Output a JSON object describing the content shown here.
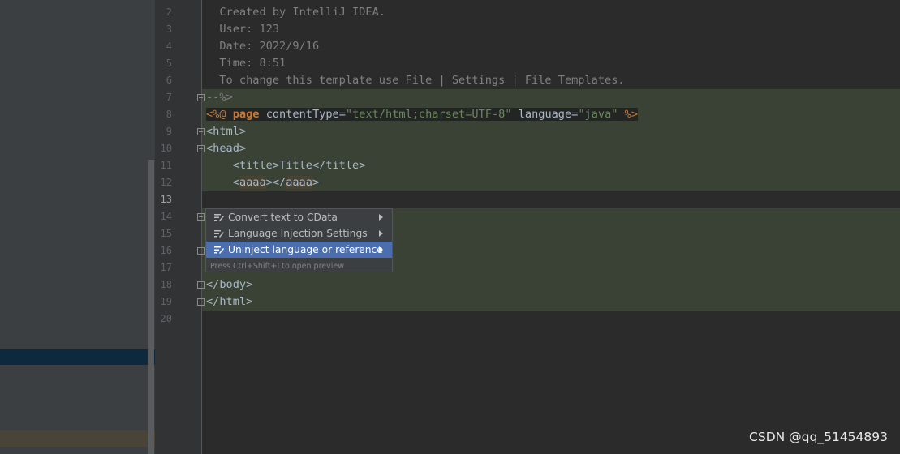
{
  "editor": {
    "lines": [
      {
        "num": "2",
        "text": "  Created by IntelliJ IDEA."
      },
      {
        "num": "3",
        "text": "  User: 123"
      },
      {
        "num": "4",
        "text": "  Date: 2022/9/16"
      },
      {
        "num": "5",
        "text": "  Time: 8:51"
      },
      {
        "num": "6",
        "text": "  To change this template use File | Settings | File Templates."
      },
      {
        "num": "7",
        "text": "--%>"
      },
      {
        "num": "8",
        "directive_open": "<%@",
        "kw": "page",
        "attr1": "contentType=",
        "val1": "\"text/html;charset=UTF-8\"",
        "attr2": "language=",
        "val2": "\"java\"",
        "directive_close": "%>"
      },
      {
        "num": "9",
        "text": "<html>"
      },
      {
        "num": "10",
        "text": "<head>"
      },
      {
        "num": "11",
        "text": "    <title>Title</title>"
      },
      {
        "num": "12",
        "indent": "    ",
        "open_lt": "<",
        "tag": "aaaa",
        "open_gt": "></",
        "tag2": "aaaa",
        "close_gt": ">"
      },
      {
        "num": "13",
        "text": ""
      },
      {
        "num": "14",
        "text": ""
      },
      {
        "num": "15",
        "text": ""
      },
      {
        "num": "16",
        "text": ""
      },
      {
        "num": "17",
        "text": ""
      },
      {
        "num": "18",
        "text": "</body>"
      },
      {
        "num": "19",
        "text": "</html>"
      },
      {
        "num": "20",
        "text": ""
      }
    ]
  },
  "popup": {
    "items": [
      {
        "label": "Convert text to CData",
        "icon": "intention-icon",
        "has_submenu": true
      },
      {
        "label": "Language Injection Settings",
        "icon": "intention-icon",
        "has_submenu": true
      },
      {
        "label": "Uninject language or reference",
        "icon": "intention-icon",
        "has_submenu": true,
        "selected": true
      }
    ],
    "hint": "Press Ctrl+Shift+I to open preview"
  },
  "watermark": "CSDN @qq_51454893",
  "colors": {
    "editor_bg": "#2b2b2b",
    "injection_bg": "#394234",
    "popup_selected": "#4b6eaf",
    "keyword": "#cc7832",
    "string": "#6a8759",
    "tag": "#e8bf6a"
  }
}
